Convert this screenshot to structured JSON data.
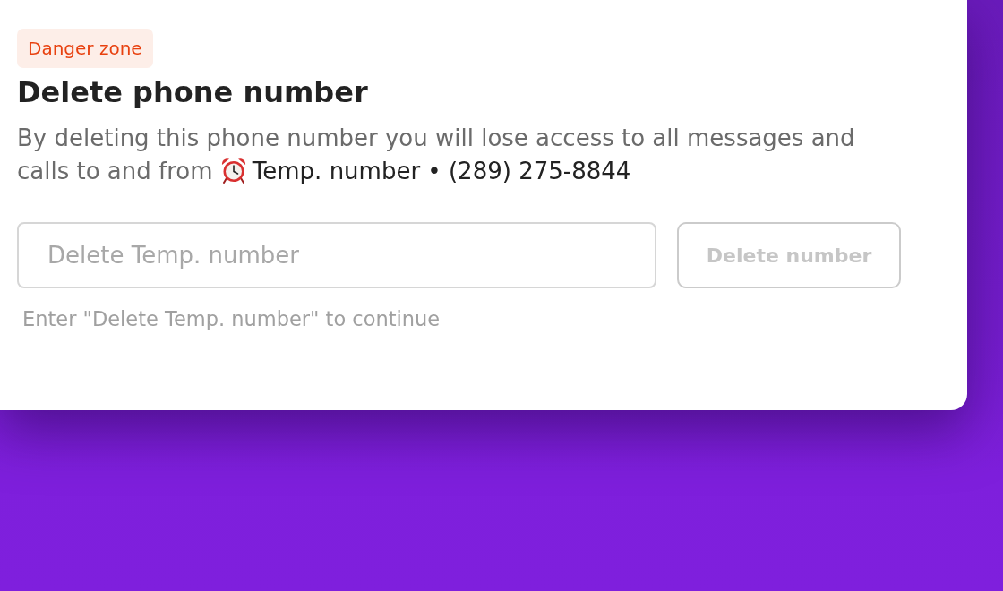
{
  "badge": {
    "label": "Danger zone"
  },
  "title": "Delete phone number",
  "description": {
    "text": "By deleting this phone number you will lose access to all messages and calls to and from",
    "subject": "Temp. number • (289) 275-8844"
  },
  "confirm_field": {
    "placeholder": "Delete Temp. number"
  },
  "delete_button": {
    "label": "Delete number",
    "disabled": true
  },
  "hint": "Enter \"Delete Temp. number\" to continue"
}
